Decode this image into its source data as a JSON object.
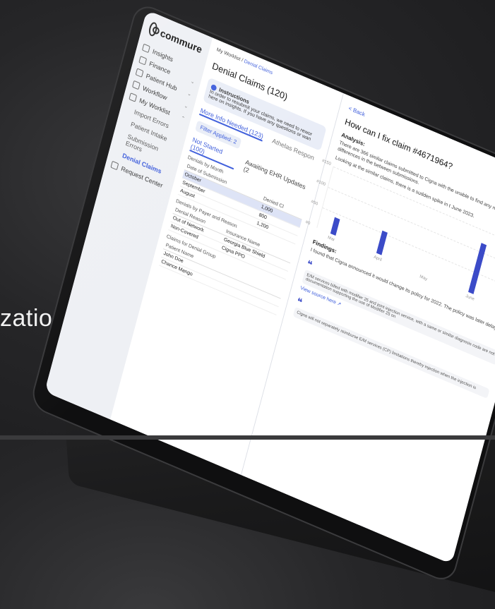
{
  "background_text": "zation,",
  "sidebar": {
    "logo": "commure",
    "items": [
      {
        "label": "Insights",
        "chevron": ""
      },
      {
        "label": "Finance",
        "chevron": "⌄"
      },
      {
        "label": "Patient Hub",
        "chevron": "⌄"
      },
      {
        "label": "Workflow",
        "chevron": "⌄"
      },
      {
        "label": "My Worklist",
        "chevron": "⌃"
      }
    ],
    "subitems": [
      "Import Errors",
      "Patient Intake",
      "Submission Errors",
      "Denial Claims"
    ],
    "footer": "Request Center"
  },
  "main": {
    "breadcrumb_root": "My Worklist /",
    "breadcrumb_current": "Denial Claims",
    "title": "Denial Claims (120)",
    "instructions_title": "Instructions",
    "instructions_text": "In order to resubmit your claims, we need to rewor here on insights. If you have any questions or wan",
    "tab_1": "More Info Needed (123)",
    "tab_2": "Athelas Respon",
    "filter": "Filter Applied: 2",
    "subtab_1": "Not Started (100)",
    "subtab_2": "Awaiting EHR Updates (2",
    "denials_by_month": "Denials by Month",
    "month_table": {
      "headers": [
        "Date of Submission",
        "Denied Cl"
      ],
      "rows": [
        [
          "October",
          "1,000"
        ],
        [
          "September",
          "800"
        ],
        [
          "August",
          "1,200"
        ]
      ]
    },
    "denials_by_payer": "Denials by Payer and Reason",
    "payer_table": {
      "headers": [
        "Denial Reason",
        "Insurance Name"
      ],
      "rows": [
        [
          "Out of Network",
          "Georgia Blue Shield"
        ],
        [
          "Non-Covered",
          "Cigna PPO"
        ]
      ]
    },
    "claims_label": "Claims for Denial Group",
    "patients_header": "Patient Name",
    "patients": [
      "John Doe",
      "Chance Mango"
    ]
  },
  "detail": {
    "back": "< Back",
    "question": "How can I fix claim #4671964?",
    "analysis_heading": "Analysis:",
    "analysis_p1": "There are 366 similar claims submitted to Cigna with the unable to find any noticeable differences in the between submissions.",
    "analysis_p2": "Looking at the similar claims, there is a sudden spike in t June 2023.",
    "findings_heading": "Findings:",
    "findings_text": "I found that Cigna announced it would change its policy for 2022. The policy was later delayed.",
    "quote_1": "E/M services billed with modifier 25 and joint injection service, with a same or similar diagnosis code are not documentation supporting the use of Modifier 25 on",
    "view_source": "View source here ↗",
    "quote_2": "Cigna will not separately reimburse E/M services (CP) limitations thereby injection when the injection is"
  },
  "chart_data": {
    "type": "bar",
    "categories": [
      "Mar",
      "April",
      "May",
      "June"
    ],
    "values": [
      40,
      55,
      0,
      120
    ],
    "ytick_labels": [
      "#0",
      "#50",
      "#100",
      "#150"
    ],
    "ylim": [
      0,
      150
    ],
    "bar_color": "#3b4bc8"
  }
}
